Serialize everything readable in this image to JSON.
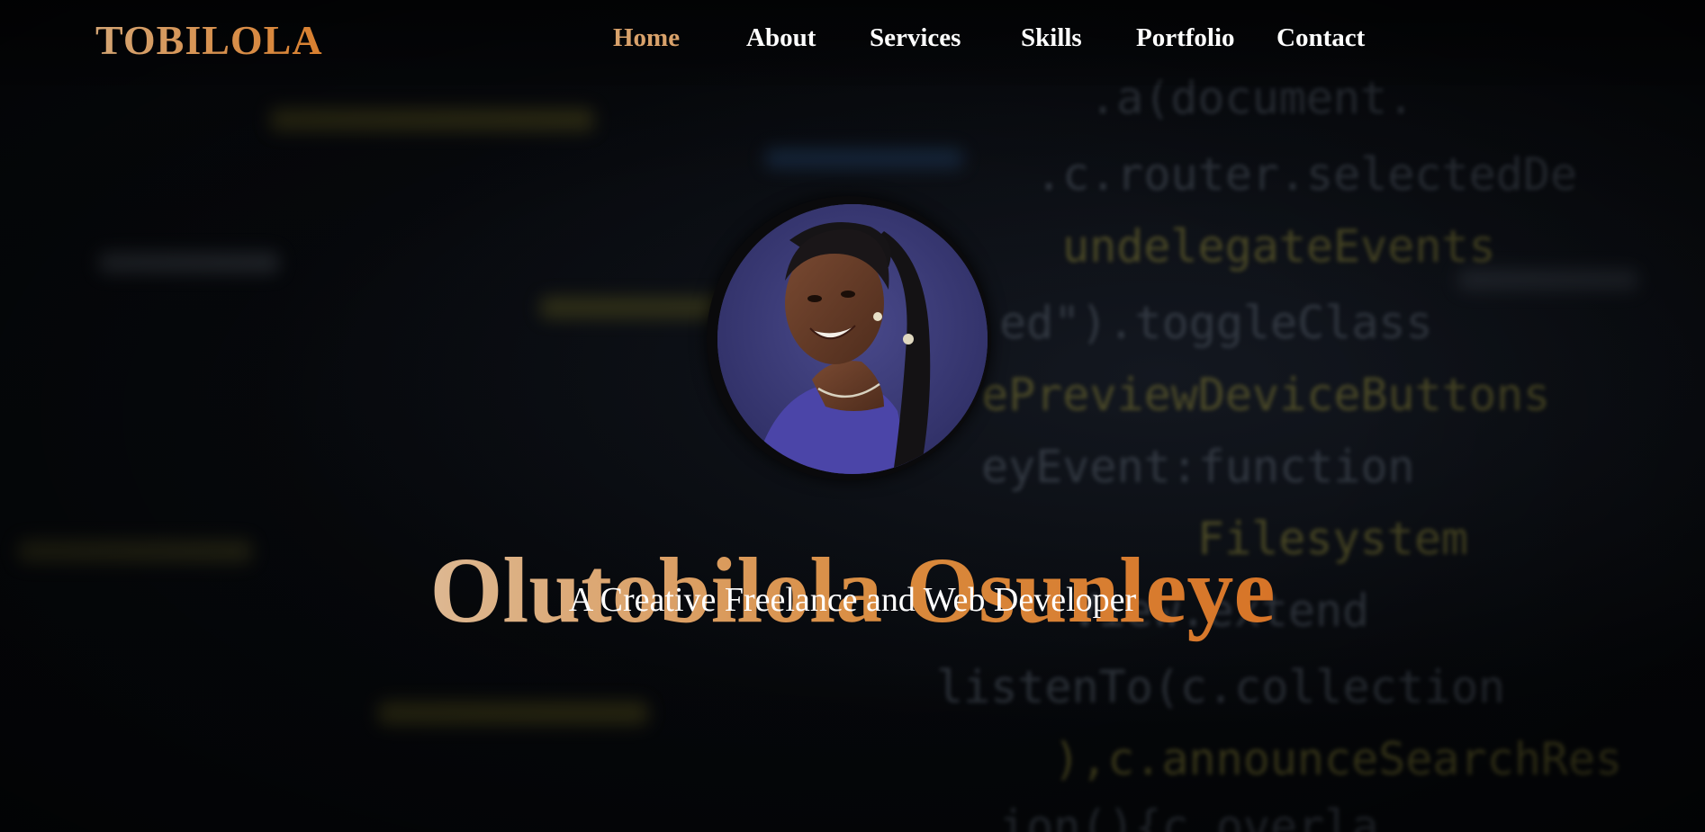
{
  "header": {
    "logo": "TOBILOLA",
    "nav": [
      {
        "label": "Home",
        "active": true
      },
      {
        "label": "About",
        "active": false
      },
      {
        "label": "Services",
        "active": false
      },
      {
        "label": "Skills",
        "active": false
      },
      {
        "label": "Portfolio",
        "active": false
      },
      {
        "label": "Contact",
        "active": false
      }
    ]
  },
  "hero": {
    "avatar_icon": "profile-photo",
    "name": "Olutobilola Osunleye",
    "tagline": "A Creative Freelance and Web Developer"
  },
  "background_code": [
    ".a(document.",
    ".c.router.selectedDe",
    "undelegateEvents",
    "ed\").toggleClass",
    "ePreviewDeviceButtons",
    "eyEvent:function",
    "Filesystem",
    "View.extend",
    "listenTo(c.collection",
    "),c.announceSearchRes",
    "ion(){c.overla"
  ],
  "theme": {
    "accent": "#d98a3d",
    "accent_light": "#d9a26b",
    "text": "#ffffff",
    "background": "#06080b"
  }
}
